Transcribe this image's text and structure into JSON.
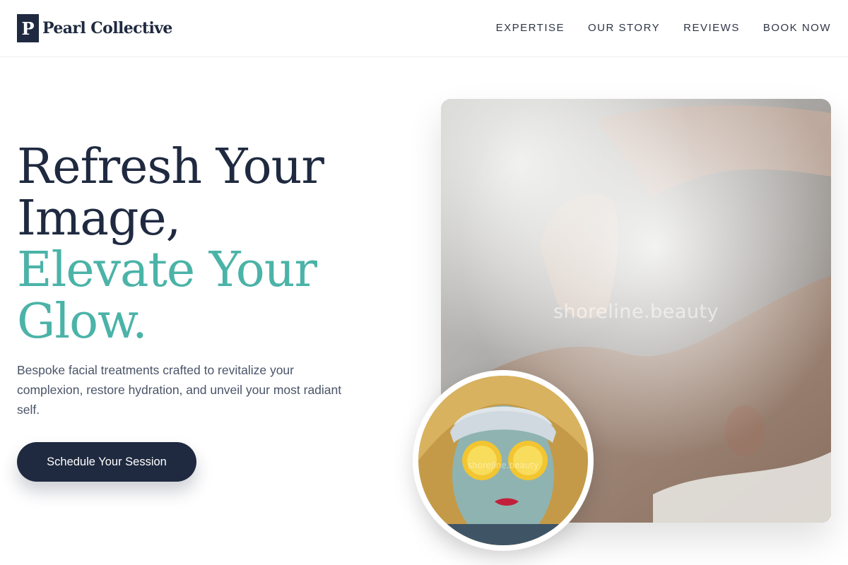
{
  "brand": {
    "mark": "P",
    "name": "Pearl Collective"
  },
  "nav": {
    "items": [
      {
        "label": "EXPERTISE"
      },
      {
        "label": "OUR STORY"
      },
      {
        "label": "REVIEWS"
      },
      {
        "label": "BOOK NOW"
      }
    ]
  },
  "hero": {
    "title_lines": [
      "Refresh Your",
      "Image,"
    ],
    "accent_lines": [
      "Elevate Your",
      "Glow."
    ],
    "description": "Bespoke facial treatments crafted to revitalize your complexion, restore hydration, and unveil your most radiant self.",
    "cta_label": "Schedule Your Session"
  },
  "images": {
    "main_watermark": "shoreline.beauty",
    "circle_watermark": "shoreline.beauty"
  },
  "colors": {
    "navy": "#1f2a40",
    "accent": "#4bb3a8",
    "body_text": "#4a5468"
  }
}
